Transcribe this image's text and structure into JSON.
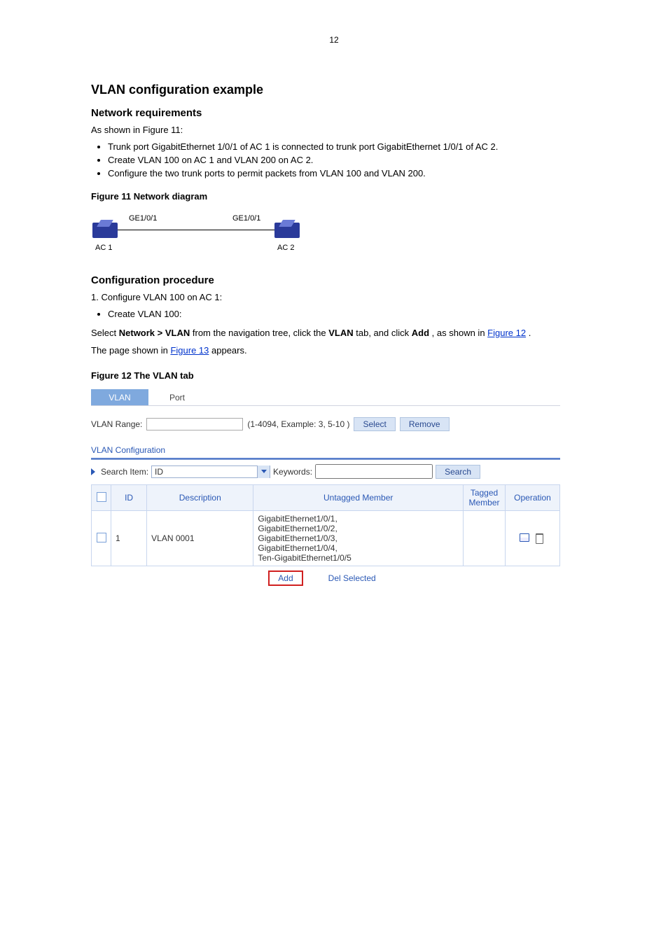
{
  "page": {
    "number": "12"
  },
  "headings": {
    "example": "VLAN configuration example",
    "netreq": "Network requirements",
    "procedure": "Configuration procedure"
  },
  "requirements": {
    "intro": "As shown in Figure 11:",
    "items": [
      "Trunk port GigabitEthernet 1/0/1 of AC 1 is connected to trunk port GigabitEthernet 1/0/1 of AC 2.",
      "Create VLAN 100 on AC 1 and VLAN 200 on AC 2.",
      "Configure the two trunk ports to permit packets from VLAN 100 and VLAN 200."
    ]
  },
  "figures": {
    "fig1": {
      "caption": "Figure 11 Network diagram",
      "labels": {
        "ge_left": "GE1/0/1",
        "ge_right": "GE1/0/1",
        "ac1": "AC 1",
        "ac2": "AC 2"
      }
    },
    "fig12": {
      "caption": "Figure 12 The VLAN tab"
    }
  },
  "procedure": {
    "step1": {
      "num": "1. ",
      "text": "Configure VLAN 100 on AC 1:",
      "sub": "Create VLAN 100:"
    },
    "nav": {
      "before": "Select ",
      "path": "Network > VLAN",
      "after": " from the navigation tree, click the ",
      "tab": "VLAN",
      "after2": " tab, and click ",
      "button": "Add",
      "after3": ", as shown in ",
      "figref": "Figure 12",
      "end": "."
    },
    "page_appears": {
      "before": "The page shown in ",
      "figref": "Figure 13",
      "after": " appears."
    }
  },
  "vlanPanel": {
    "tabs": [
      "VLAN",
      "Port"
    ],
    "range": {
      "label": "VLAN Range:",
      "value": "",
      "hint": "(1-4094, Example: 3, 5-10 )",
      "selectBtn": "Select",
      "removeBtn": "Remove"
    },
    "configTitle": "VLAN Configuration",
    "search": {
      "itemLabel": "Search Item:",
      "itemValue": "ID",
      "kwLabel": "Keywords:",
      "kwValue": "",
      "btn": "Search"
    },
    "table": {
      "headers": [
        "ID",
        "Description",
        "Untagged Member",
        "Tagged Member",
        "Operation"
      ],
      "rows": [
        {
          "id": "1",
          "description": "VLAN 0001",
          "untagged": "GigabitEthernet1/0/1,\nGigabitEthernet1/0/2,\nGigabitEthernet1/0/3,\nGigabitEthernet1/0/4,\nTen-GigabitEthernet1/0/5",
          "tagged": ""
        }
      ]
    },
    "actions": {
      "add": "Add",
      "delSelected": "Del Selected"
    }
  }
}
